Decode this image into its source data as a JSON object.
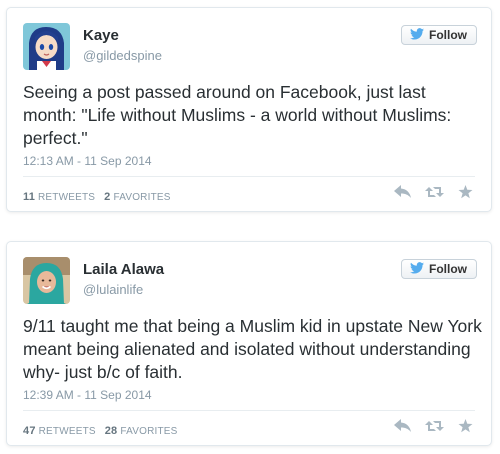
{
  "tweets": [
    {
      "name": "Kaye",
      "handle": "@gildedspine",
      "follow_label": "Follow",
      "text": "Seeing a post passed around on Facebook, just last month: \"Life without Muslims - a world without Muslims: perfect.\"",
      "timestamp": "12:13 AM - 11 Sep 2014",
      "retweets_count": "11",
      "retweets_label": "RETWEETS",
      "favorites_count": "2",
      "favorites_label": "FAVORITES"
    },
    {
      "name": "Laila Alawa",
      "handle": "@lulainlife",
      "follow_label": "Follow",
      "text": "9/11 taught me that being a Muslim kid in upstate New York meant being alienated and isolated without understanding why- just b/c of faith.",
      "timestamp": "12:39 AM - 11 Sep 2014",
      "retweets_count": "47",
      "retweets_label": "RETWEETS",
      "favorites_count": "28",
      "favorites_label": "FAVORITES"
    }
  ],
  "colors": {
    "twitter_blue": "#55acee",
    "muted_text": "#8899a6",
    "icon_gray": "#aab8c2"
  },
  "icons": [
    "twitter-bird-icon",
    "reply-icon",
    "retweet-icon",
    "favorite-star-icon"
  ]
}
